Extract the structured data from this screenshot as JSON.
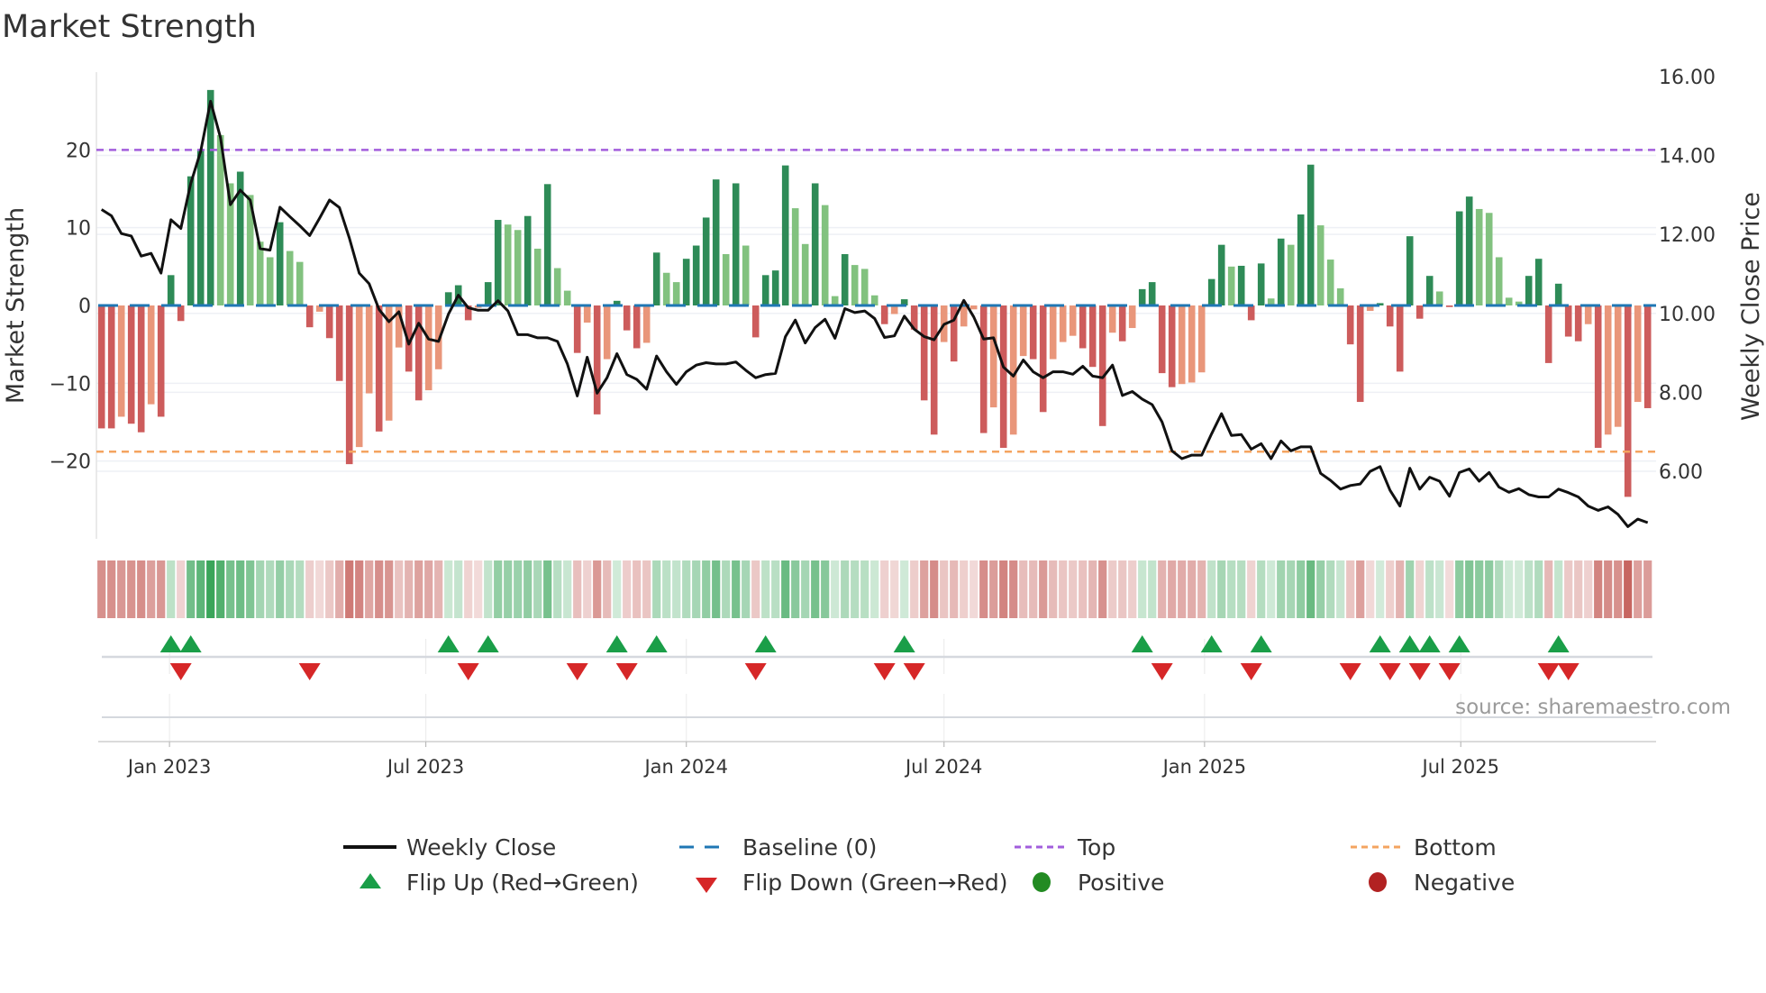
{
  "chart_data": {
    "type": "bar",
    "title": "Market Strength",
    "ylabel_left": "Market Strength",
    "ylabel_right": "Weekly Close Price",
    "source": "source: sharemaestro.com",
    "start_date": "2022-11-14",
    "frequency": "weekly",
    "ylim_left": [
      -30,
      30
    ],
    "ylim_right": [
      4.29,
      16.11
    ],
    "left_ticks": [
      {
        "v": 20,
        "label": "20"
      },
      {
        "v": 10,
        "label": "10"
      },
      {
        "v": 0,
        "label": "0"
      },
      {
        "v": -10,
        "label": "−10"
      },
      {
        "v": -20,
        "label": "−20"
      }
    ],
    "right_ticks": [
      {
        "v": 16,
        "label": "16.00"
      },
      {
        "v": 14,
        "label": "14.00"
      },
      {
        "v": 12,
        "label": "12.00"
      },
      {
        "v": 10,
        "label": "10.00"
      },
      {
        "v": 8,
        "label": "8.00"
      },
      {
        "v": 6,
        "label": "6.00"
      }
    ],
    "x_ticks": [
      {
        "date": "2023-01-01",
        "label": "Jan 2023"
      },
      {
        "date": "2023-07-01",
        "label": "Jul 2023"
      },
      {
        "date": "2024-01-01",
        "label": "Jan 2024"
      },
      {
        "date": "2024-07-01",
        "label": "Jul 2024"
      },
      {
        "date": "2025-01-01",
        "label": "Jan 2025"
      },
      {
        "date": "2025-07-01",
        "label": "Jul 2025"
      }
    ],
    "top_level": 20,
    "bottom_level": -18.8,
    "baseline": 0,
    "strength": [
      -15.8,
      -15.8,
      -14.3,
      -15.2,
      -16.3,
      -12.7,
      -14.3,
      3.9,
      -2.0,
      16.6,
      20.0,
      27.7,
      21.9,
      15.7,
      17.2,
      14.2,
      8.2,
      6.2,
      10.7,
      7.0,
      5.6,
      -2.8,
      -0.8,
      -4.2,
      -9.7,
      -20.4,
      -18.2,
      -11.3,
      -16.2,
      -14.8,
      -5.4,
      -8.5,
      -12.2,
      -10.9,
      -8.2,
      1.7,
      2.6,
      -1.9,
      -0.3,
      3.0,
      11.0,
      10.4,
      9.7,
      11.5,
      7.3,
      15.6,
      4.8,
      1.9,
      -6.1,
      -2.2,
      -14.0,
      -6.9,
      0.6,
      -3.2,
      -5.5,
      -4.8,
      6.8,
      4.2,
      3.0,
      6.0,
      7.7,
      11.3,
      16.2,
      6.6,
      15.7,
      7.7,
      -4.1,
      3.9,
      4.5,
      18.0,
      12.5,
      7.9,
      15.7,
      12.9,
      1.2,
      6.6,
      5.2,
      4.7,
      1.3,
      -2.4,
      -1.1,
      0.8,
      -3.1,
      -12.2,
      -16.6,
      -4.7,
      -7.2,
      -2.7,
      -0.5,
      -16.4,
      -13.1,
      -18.3,
      -16.6,
      -6.5,
      -6.9,
      -13.7,
      -6.9,
      -4.7,
      -3.9,
      -5.5,
      -7.9,
      -15.5,
      -3.5,
      -4.6,
      -2.9,
      2.1,
      3.0,
      -8.7,
      -10.5,
      -10.1,
      -9.9,
      -8.6,
      3.4,
      7.8,
      5.0,
      5.1,
      -1.9,
      5.4,
      0.9,
      8.6,
      7.8,
      11.7,
      18.1,
      10.3,
      5.9,
      2.2,
      -5.0,
      -12.4,
      -0.7,
      0.3,
      -2.7,
      -8.5,
      8.9,
      -1.7,
      3.8,
      1.8,
      -0.2,
      12.1,
      14.0,
      12.4,
      11.9,
      6.2,
      1.0,
      0.5,
      3.8,
      6.0,
      -7.4,
      2.8,
      -4.0,
      -4.6,
      -2.4,
      -18.3,
      -16.6,
      -15.6,
      -24.6,
      -12.4,
      -13.2
    ],
    "weekly_close": [
      12.63,
      12.47,
      12.02,
      11.96,
      11.45,
      11.52,
      11.02,
      12.37,
      12.15,
      13.29,
      14.1,
      15.37,
      14.45,
      12.75,
      13.12,
      12.87,
      11.64,
      11.6,
      12.69,
      12.45,
      12.22,
      11.97,
      12.41,
      12.87,
      12.68,
      11.91,
      11.02,
      10.75,
      10.1,
      9.79,
      10.04,
      9.22,
      9.75,
      9.35,
      9.29,
      9.98,
      10.46,
      10.14,
      10.08,
      10.08,
      10.32,
      10.06,
      9.46,
      9.46,
      9.38,
      9.38,
      9.29,
      8.72,
      7.91,
      8.89,
      7.98,
      8.37,
      8.98,
      8.45,
      8.33,
      8.08,
      8.92,
      8.52,
      8.2,
      8.52,
      8.69,
      8.75,
      8.72,
      8.72,
      8.77,
      8.56,
      8.37,
      8.45,
      8.48,
      9.41,
      9.83,
      9.25,
      9.64,
      9.85,
      9.37,
      10.12,
      10.02,
      10.06,
      9.87,
      9.39,
      9.43,
      9.93,
      9.6,
      9.41,
      9.33,
      9.72,
      9.83,
      10.33,
      9.91,
      9.35,
      9.38,
      8.64,
      8.41,
      8.82,
      8.52,
      8.37,
      8.52,
      8.52,
      8.46,
      8.66,
      8.41,
      8.37,
      8.69,
      7.92,
      8.02,
      7.83,
      7.69,
      7.25,
      6.52,
      6.32,
      6.41,
      6.41,
      6.95,
      7.46,
      6.91,
      6.93,
      6.56,
      6.7,
      6.32,
      6.77,
      6.52,
      6.62,
      6.62,
      5.95,
      5.77,
      5.55,
      5.64,
      5.68,
      6.0,
      6.12,
      5.52,
      5.12,
      6.08,
      5.55,
      5.85,
      5.75,
      5.37,
      5.97,
      6.06,
      5.75,
      5.97,
      5.6,
      5.47,
      5.56,
      5.41,
      5.35,
      5.35,
      5.55,
      5.46,
      5.35,
      5.12,
      5.01,
      5.1,
      4.91,
      4.6,
      4.79,
      4.7
    ],
    "flip_up_weeks": [
      7,
      9,
      35,
      39,
      52,
      56,
      67,
      81,
      105,
      112,
      117,
      129,
      132,
      134,
      137,
      147
    ],
    "flip_down_weeks": [
      8,
      21,
      37,
      48,
      53,
      66,
      79,
      82,
      107,
      116,
      126,
      130,
      133,
      136,
      146,
      148
    ],
    "legend": [
      {
        "key": "close",
        "label": "Weekly Close"
      },
      {
        "key": "baseline",
        "label": "Baseline (0)"
      },
      {
        "key": "top",
        "label": "Top"
      },
      {
        "key": "bottom",
        "label": "Bottom"
      },
      {
        "key": "flip_up",
        "label": "Flip Up (Red→Green)"
      },
      {
        "key": "flip_down",
        "label": "Flip Down (Green→Red)"
      },
      {
        "key": "positive",
        "label": "Positive"
      },
      {
        "key": "negative",
        "label": "Negative"
      }
    ],
    "colors": {
      "pos_strong": "#2e8b57",
      "pos_weak": "#82c27f",
      "neg_strong": "#cd5c5c",
      "neg_weak": "#e9967a",
      "baseline": "#1f77b4",
      "top": "#a25ddc",
      "bottom": "#f4a460",
      "close": "#111111",
      "flip_up": "#1a9e48",
      "flip_down": "#d62728",
      "positive": "#228b22",
      "negative": "#b22222"
    }
  }
}
